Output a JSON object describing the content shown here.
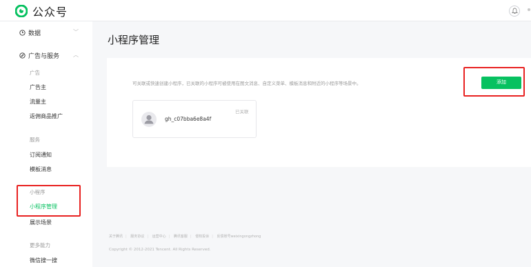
{
  "header": {
    "brand": "公众号",
    "logo_icon": "wechat-official-account-logo",
    "bell_icon": "bell-icon"
  },
  "sidebar": {
    "data_group": "数据",
    "ads_group": "广告与服务",
    "ads_head": "广告",
    "advertiser": "广告主",
    "traffic_owner": "流量主",
    "rebate_promo": "返佣商品推广",
    "service_head": "服务",
    "subscription_notice": "订阅通知",
    "template_message": "模板消息",
    "miniprogram_head": "小程序",
    "miniprogram_manage": "小程序管理",
    "display_scene": "展示场景",
    "more_head": "更多能力",
    "wechat_search": "微信搜一搜"
  },
  "main": {
    "title": "小程序管理",
    "description": "可关联或快速创建小程序，已关联的小程序可被使用在图文消息、自定义菜单、模板消息和附近的小程序等场景中。",
    "add_label": "添加",
    "miniprogram": {
      "name": "gh_c07bba6e8a4f",
      "status": "已关联"
    }
  },
  "footer": {
    "links": [
      "关于腾讯",
      "服务协议",
      "运营中心",
      "腾讯客服",
      "侵权投诉",
      "反馈账号weixingongzhong"
    ],
    "copyright": "Copyright © 2012-2021 Tencent. All Rights Reserved."
  },
  "colors": {
    "accent": "#07c160",
    "highlight_border": "#e8201f"
  }
}
